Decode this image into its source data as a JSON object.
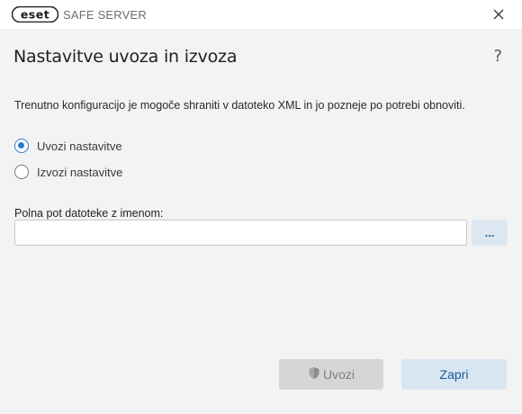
{
  "app": {
    "logo_text": "eset",
    "product_name": "SAFE SERVER"
  },
  "header": {
    "title": "Nastavitve uvoza in izvoza",
    "help_glyph": "?"
  },
  "description": "Trenutno konfiguracijo je mogoče shraniti v datoteko XML in jo pozneje po potrebi obnoviti.",
  "options": [
    {
      "label": "Uvozi nastavitve",
      "checked": true
    },
    {
      "label": "Izvozi nastavitve",
      "checked": false
    }
  ],
  "path_field": {
    "label": "Polna pot datoteke z imenom:",
    "value": "",
    "browse_label": "..."
  },
  "buttons": {
    "import_label": "Uvozi",
    "import_enabled": false,
    "close_label": "Zapri"
  },
  "colors": {
    "accent": "#2b7bd1",
    "background": "#f3f3f4",
    "disabled_button": "#d6d6d6",
    "secondary_button": "#d8e6f2"
  },
  "icons": {
    "logo": "eset-logo",
    "close": "close-icon",
    "help": "help-icon",
    "shield": "shield-icon"
  }
}
